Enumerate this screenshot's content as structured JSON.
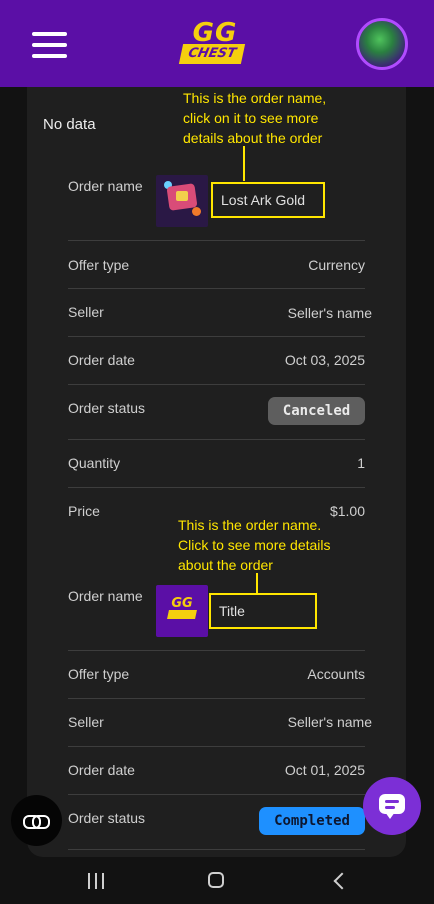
{
  "header": {
    "logo_gg": "GG",
    "logo_chest": "CHEST"
  },
  "no_data": "No data",
  "order1": {
    "annotation": "This is the order name, click on it to see more details about the order",
    "annotation_lines": [
      "This is the order name,",
      "click on it to see more",
      "details about the order"
    ],
    "order_name_label": "Order name",
    "order_name": "Lost Ark Gold",
    "offer_type_label": "Offer type",
    "offer_type": "Currency",
    "seller_label": "Seller",
    "seller": "Seller's name",
    "order_date_label": "Order date",
    "order_date": "Oct 03, 2025",
    "order_status_label": "Order status",
    "order_status": "Canceled",
    "quantity_label": "Quantity",
    "quantity": "1",
    "price_label": "Price",
    "price": "$1.00"
  },
  "order2": {
    "annotation_lines": [
      "This is the order name.",
      "Click to see more details",
      "about the order"
    ],
    "order_name_label": "Order name",
    "order_name": "Title",
    "offer_type_label": "Offer type",
    "offer_type": "Accounts",
    "seller_label": "Seller",
    "seller": "Seller's name",
    "order_date_label": "Order date",
    "order_date": "Oct 01, 2025",
    "order_status_label": "Order status",
    "order_status": "Completed"
  },
  "colors": {
    "brand_purple": "#5b0fa6",
    "brand_yellow": "#f5cf0e",
    "annotation_yellow": "#ffe600",
    "status_canceled": "#5e5e5e",
    "status_completed": "#1e90ff",
    "chat_button": "#7c2fd6"
  },
  "icons": {
    "menu": "hamburger-menu-icon",
    "avatar": "user-avatar",
    "chat": "chat-bubble-icon",
    "link": "link-icon",
    "nav_recent": "recent-apps-icon",
    "nav_home": "home-icon",
    "nav_back": "back-icon"
  }
}
